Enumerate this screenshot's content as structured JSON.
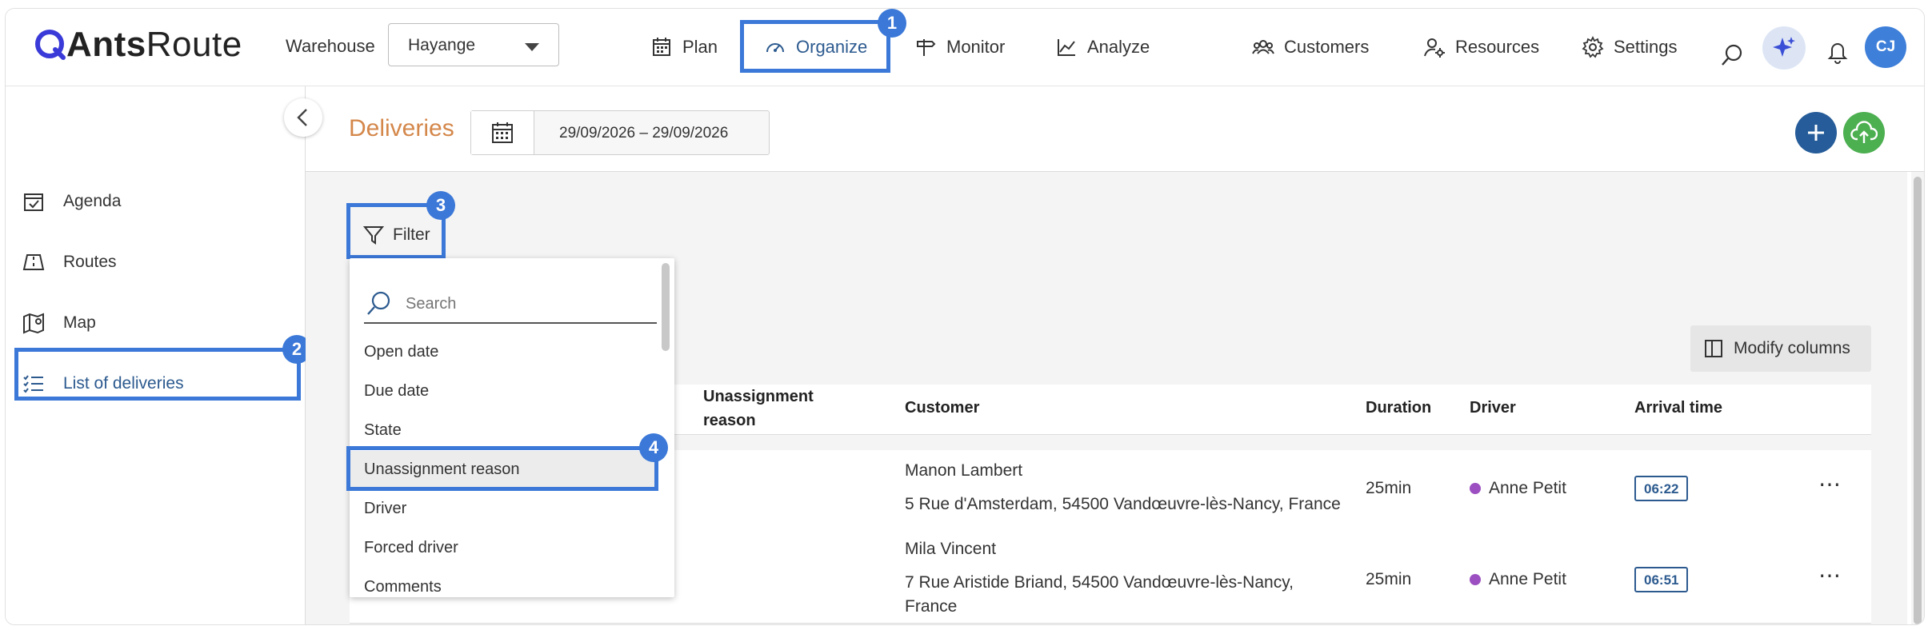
{
  "header": {
    "logo_text_bold": "Ants",
    "logo_text_regular": "Route",
    "warehouse_label": "Warehouse",
    "warehouse_value": "Hayange",
    "nav": {
      "plan": "Plan",
      "organize": "Organize",
      "monitor": "Monitor",
      "analyze": "Analyze",
      "customers": "Customers",
      "resources": "Resources",
      "settings": "Settings"
    },
    "avatar_initials": "CJ"
  },
  "sidebar": {
    "items": [
      {
        "label": "Agenda",
        "icon": "calendar-check-icon"
      },
      {
        "label": "Routes",
        "icon": "routes-icon"
      },
      {
        "label": "Map",
        "icon": "map-icon"
      },
      {
        "label": "List of deliveries",
        "icon": "list-icon"
      }
    ]
  },
  "page": {
    "title": "Deliveries",
    "date_range": "29/09/2026 – 29/09/2026"
  },
  "toolbar": {
    "filter_label": "Filter",
    "modify_columns_label": "Modify columns"
  },
  "filter_dropdown": {
    "search_placeholder": "Search",
    "options": [
      "Open date",
      "Due date",
      "State",
      "Unassignment reason",
      "Driver",
      "Forced driver",
      "Comments"
    ],
    "highlighted": "Unassignment reason"
  },
  "table": {
    "columns": {
      "unassignment_reason_line1": "Unassignment",
      "unassignment_reason_line2": "reason",
      "customer": "Customer",
      "duration": "Duration",
      "driver": "Driver",
      "arrival_time": "Arrival time"
    },
    "rows": [
      {
        "customer_name": "Manon Lambert",
        "address_line1": "5 Rue d'Amsterdam, 54500 Vandœuvre-lès-Nancy, France",
        "address_line2": "",
        "duration": "25min",
        "driver": "Anne Petit",
        "arrival": "06:22"
      },
      {
        "customer_name": "Mila Vincent",
        "address_line1": "7 Rue Aristide Briand, 54500 Vandœuvre-lès-Nancy,",
        "address_line2": "France",
        "duration": "25min",
        "driver": "Anne Petit",
        "arrival": "06:51"
      }
    ]
  },
  "annotations": {
    "step1": "1",
    "step2": "2",
    "step3": "3",
    "step4": "4"
  },
  "colors": {
    "highlight": "#3b78d8",
    "title_accent": "#d4874a",
    "add_button": "#255c99",
    "upload_button": "#4caf50",
    "driver_dot": "#9b4fc0"
  }
}
